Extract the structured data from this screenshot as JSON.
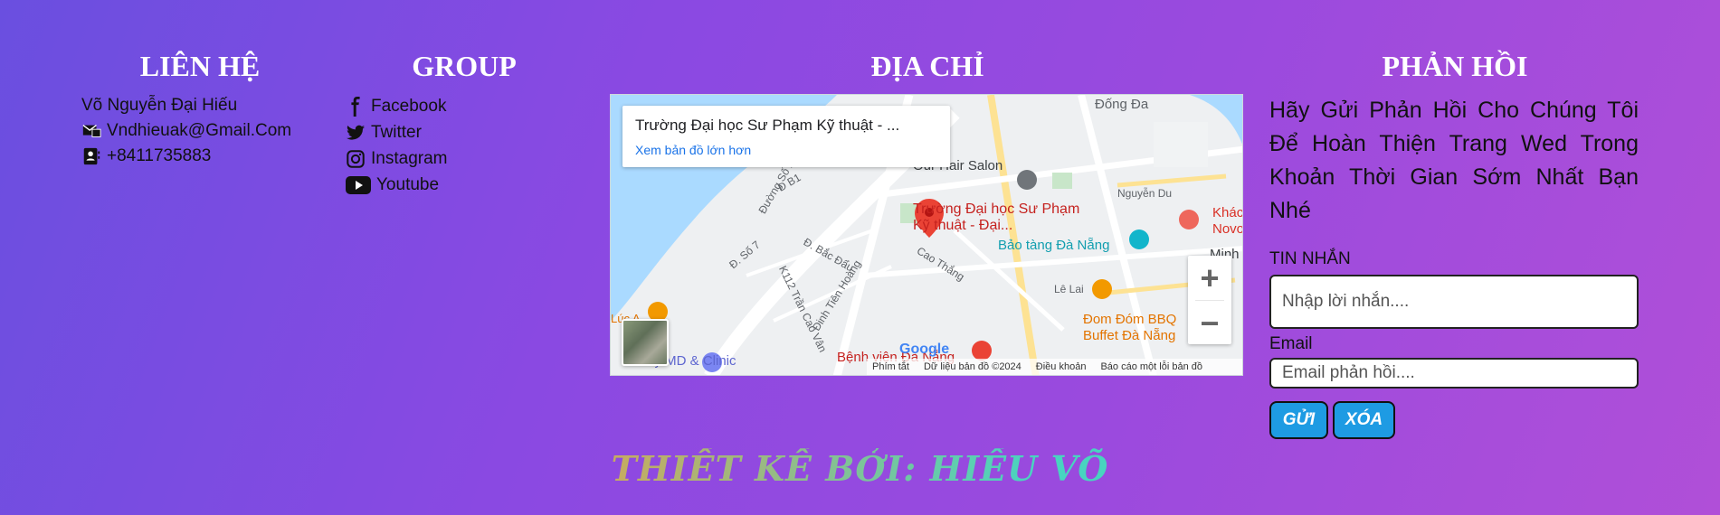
{
  "contact": {
    "title": "LIÊN HỆ",
    "name": "Võ Nguyễn Đại Hiếu",
    "email": "Vndhieuak@Gmail.Com",
    "phone": "+8411735883"
  },
  "group": {
    "title": "GROUP",
    "items": [
      {
        "label": "Facebook",
        "icon": "facebook-icon"
      },
      {
        "label": "Twitter",
        "icon": "twitter-icon"
      },
      {
        "label": "Instagram",
        "icon": "instagram-icon"
      },
      {
        "label": "Youtube",
        "icon": "youtube-icon"
      }
    ]
  },
  "address": {
    "title": "ĐỊA CHỈ",
    "map": {
      "place_name": "Trường Đại học Sư Phạm Kỹ thuật - ...",
      "view_larger": "Xem bản đồ lớn hơn",
      "pin_label": "Trường Đại học Sư Phạm Kỹ thuật -  Đại...",
      "labels": [
        "Đống Đa",
        "Our Hair Salon",
        "Nguyễn Du",
        "Bảo tàng Đà Nẵng",
        "Lê Lai",
        "Đom Đóm BBQ Buffet Đà Nẵng",
        "Bệnh viện Đà Nẵng",
        "Cao Thắng",
        "Đinh Tiên Hoàng",
        "K112 Trần Cao Vân",
        "Đ. Bắc Đẩu",
        "Đ. Số 7",
        "Đường Số 2",
        "Đ B1",
        "Khác Novo",
        "Minh",
        "Lúc A",
        "My MD & Clinic",
        "Google"
      ],
      "attribution": [
        "Phím tắt",
        "Dữ liệu bản đồ ©2024",
        "Điều khoản",
        "Báo cáo một lỗi bản đồ"
      ],
      "zoom_in": "+",
      "zoom_out": "−"
    }
  },
  "feedback": {
    "title": "PHẢN HỒI",
    "intro": "Hãy Gửi Phản Hồi Cho Chúng Tôi Để Hoàn Thiện Trang Wed Trong Khoản Thời Gian Sớm Nhất Bạn Nhé",
    "message_label": "TIN NHẮN",
    "message_placeholder": "Nhập lời nhắn....",
    "email_label": "Email",
    "email_placeholder": "Email phản hồi....",
    "send_label": "GỬI",
    "clear_label": "XÓA"
  },
  "credit": "THIẾT KẾ BỞI: HIẾU VÕ",
  "colors": {
    "button": "#1e9be3",
    "credit_gradient_start": "#f3b63a",
    "credit_gradient_end": "#3ed5b8",
    "map_pin": "#ea4335",
    "map_link": "#1a73e8"
  }
}
